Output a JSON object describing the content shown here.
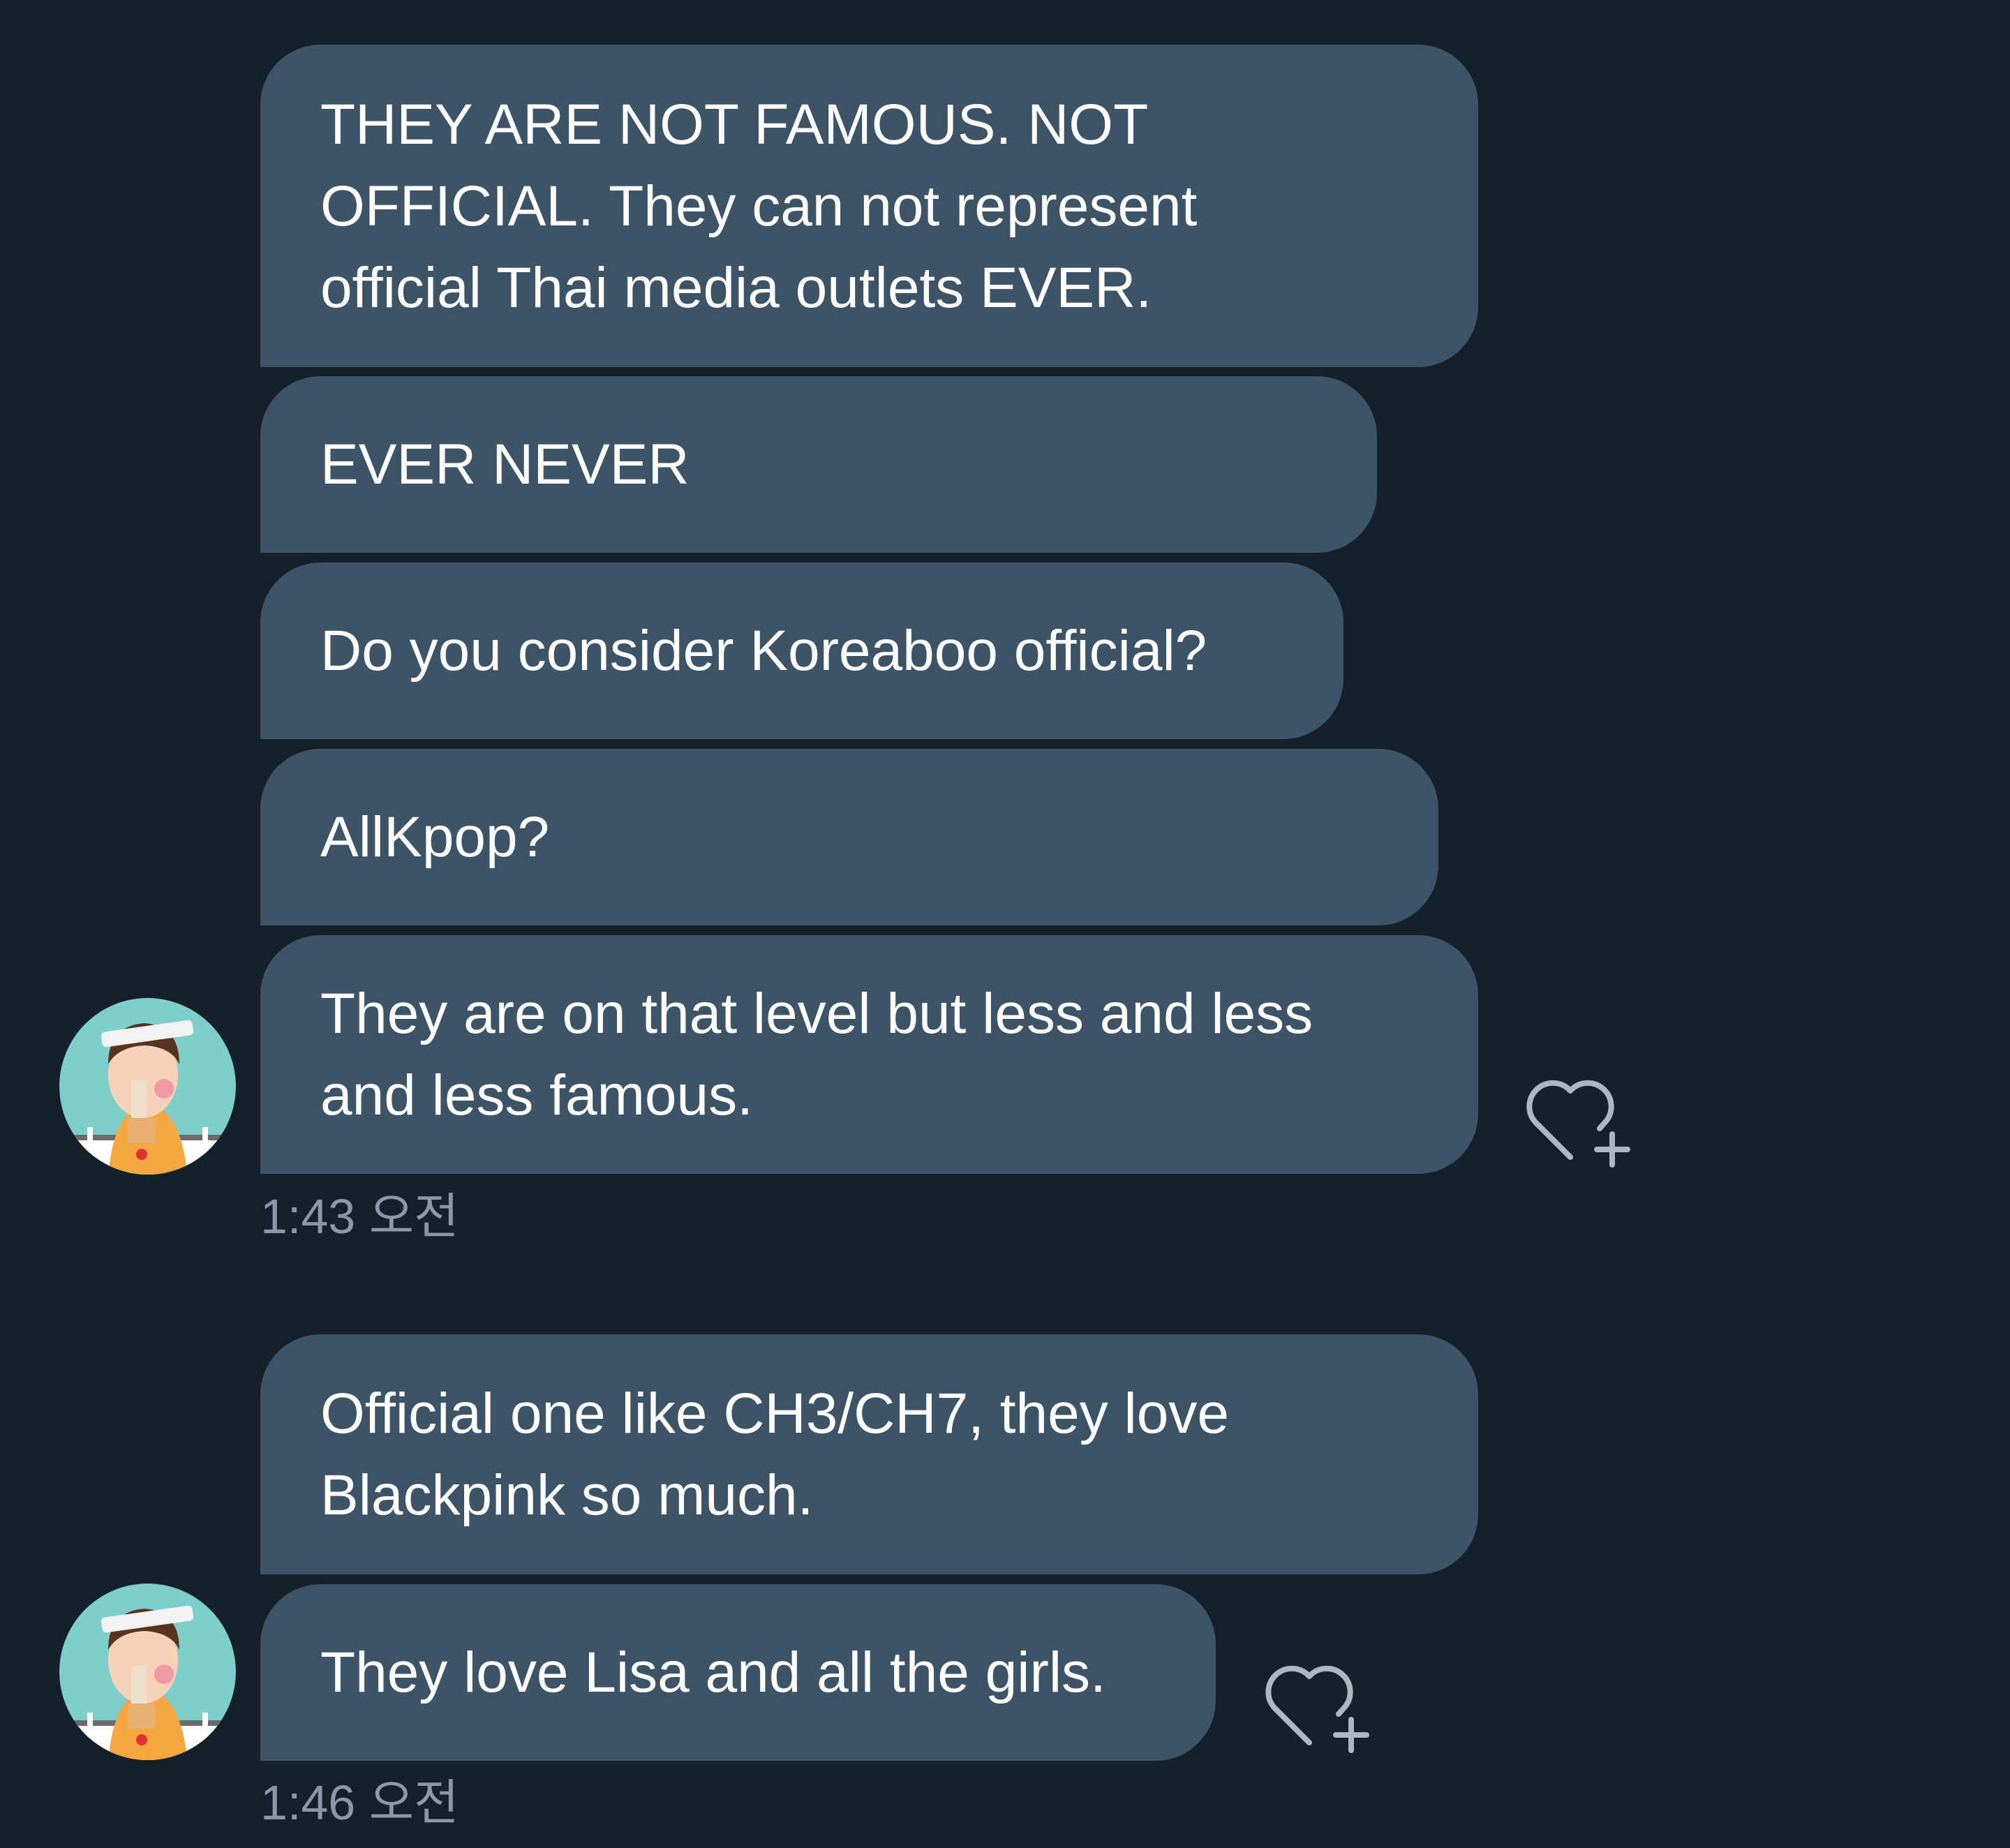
{
  "conversation": {
    "groups": [
      {
        "messages": [
          {
            "lines": [
              "THEY ARE NOT FAMOUS. NOT",
              "OFFICIAL. They can not represent",
              "official Thai media outlets EVER."
            ]
          },
          {
            "lines": [
              "EVER NEVER"
            ]
          },
          {
            "lines": [
              "Do you consider Koreaboo official?"
            ]
          },
          {
            "lines": [
              "AllKpop?"
            ]
          },
          {
            "lines": [
              "They are on that level but less and less",
              "and less famous."
            ]
          }
        ],
        "timestamp": "1:43 오전",
        "avatar_icon": "user-avatar-icon",
        "reaction_icon": "heart-plus-icon"
      },
      {
        "messages": [
          {
            "lines": [
              "Official one like CH3/CH7, they love",
              "Blackpink so much."
            ]
          },
          {
            "lines": [
              "They love Lisa and all the girls."
            ]
          }
        ],
        "timestamp": "1:46 오전",
        "avatar_icon": "user-avatar-icon",
        "reaction_icon": "heart-plus-icon"
      }
    ]
  },
  "colors": {
    "background": "#15202b",
    "bubble": "#3d5466",
    "text": "#ffffff",
    "timestamp": "#8b98a5",
    "icon": "#aab8c2"
  }
}
